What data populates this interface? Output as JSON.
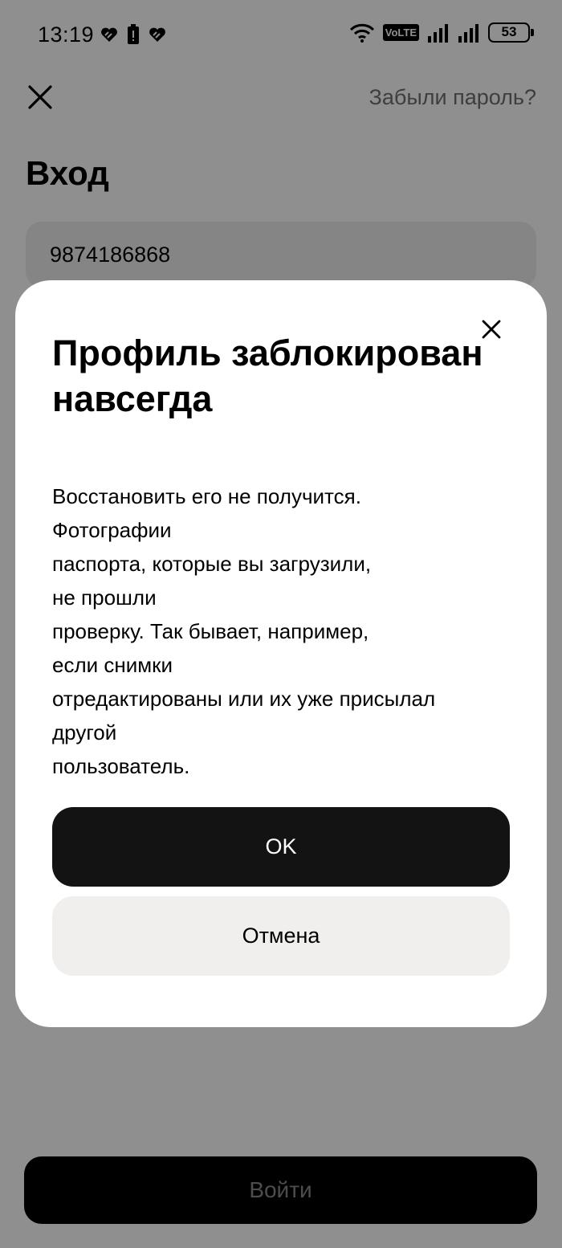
{
  "status_bar": {
    "time": "13:19",
    "volte": "VoLTE",
    "battery": "53",
    "icons": [
      "heart-icon",
      "battery-alert-icon",
      "heart-icon",
      "wifi-icon",
      "signal-icon",
      "signal-icon"
    ]
  },
  "login": {
    "forgot_password": "Забыли пароль?",
    "title": "Вход",
    "phone_value": "9874186868",
    "submit_label": "Войти"
  },
  "modal": {
    "title": "Профиль заблокирован навсегда",
    "body_lines": [
      "Восстановить его не получится.",
      "Фотографии",
      "паспорта, которые вы загрузили,",
      "не прошли",
      "проверку. Так бывает, например,",
      "если снимки",
      "отредактированы или их уже присылал",
      "другой",
      "пользователь."
    ],
    "ok_label": "OK",
    "cancel_label": "Отмена"
  },
  "colors": {
    "overlay": "#8f8f8f",
    "primary_button": "#131313",
    "secondary_button": "#f0efed",
    "muted_text": "#6f6f6f"
  }
}
